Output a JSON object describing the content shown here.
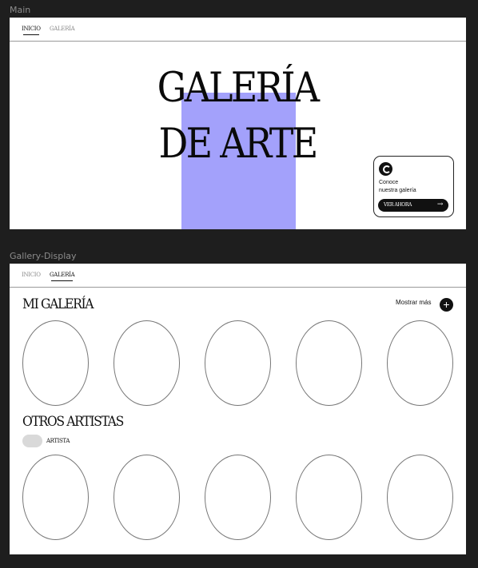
{
  "frames": {
    "main_label": "Main",
    "gallery_label": "Gallery-Display"
  },
  "main": {
    "nav": {
      "items": [
        "INICIO",
        "GALERÍA"
      ]
    },
    "hero": {
      "line1": "GALERÍA",
      "line2": "DE ARTE"
    },
    "card": {
      "line1": "Conoce",
      "line2": "nuestra galería",
      "button": "VER AHORA",
      "arrow": "→"
    }
  },
  "gallery": {
    "nav": {
      "items": [
        "INICIO",
        "GALERÍA"
      ]
    },
    "my_gallery_title": "MI GALERÍA",
    "show_more": "Mostrar más",
    "plus": "+",
    "other_artists_title": "OTROS ARTISTAS",
    "artist_chip": "ARTISTA"
  },
  "colors": {
    "background": "#1e1e1e",
    "accent": "#a3a1fb",
    "ink": "#111111"
  }
}
